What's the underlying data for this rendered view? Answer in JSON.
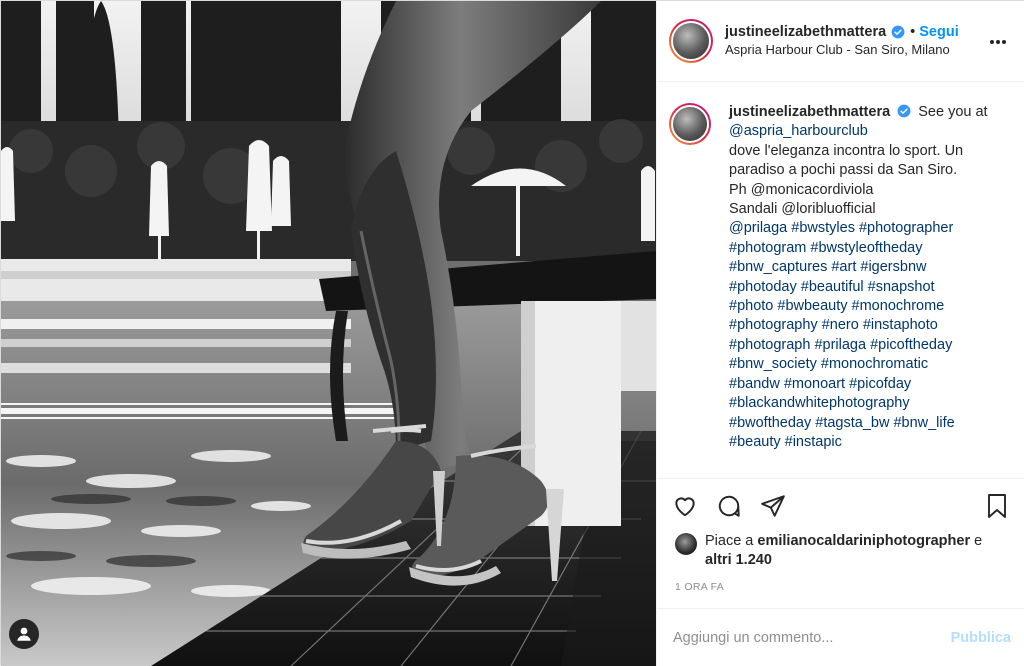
{
  "post": {
    "username": "justineelizabethmattera",
    "follow_label": "Segui",
    "separator": "•",
    "location": "Aspria Harbour Club - San Siro, Milano",
    "verified_icon": "verified-badge-icon",
    "more_icon": "more-options-icon"
  },
  "caption": {
    "username": "justineelizabethmattera",
    "lines": [
      "See you at",
      "@aspria_harbourclub",
      "dove l'eleganza incontra lo sport. Un",
      "paradiso a pochi passi da San Siro.",
      "Ph @monicacordiviola",
      "Sandali @loribluofficial",
      "@prilaga #bwstyles #photographer",
      "#photogram #bwstyleoftheday",
      "#bnw_captures #art #igersbnw",
      "#photoday #beautiful #snapshot",
      "#photo #bwbeauty #monochrome",
      "#photography #nero #instaphoto",
      "#photograph #prilaga #picoftheday",
      "#bnw_society #monochromatic",
      "#bandw #monoart #picofday",
      "#blackandwhitephotography",
      "#bwoftheday #tagsta_bw #bnw_life",
      "#beauty #instapic"
    ]
  },
  "actions": {
    "like_icon": "heart-icon",
    "comment_icon": "comment-icon",
    "share_icon": "share-icon",
    "save_icon": "bookmark-icon"
  },
  "likes": {
    "prefix": "Piace a",
    "liker": "emilianocaldariniphotographer",
    "and": "e",
    "others": "altri 1.240"
  },
  "time_ago": "1 ORA FA",
  "comment": {
    "placeholder": "Aggiungi un commento...",
    "publish_label": "Pubblica"
  },
  "photo": {
    "tag_icon": "user-tag-icon"
  }
}
